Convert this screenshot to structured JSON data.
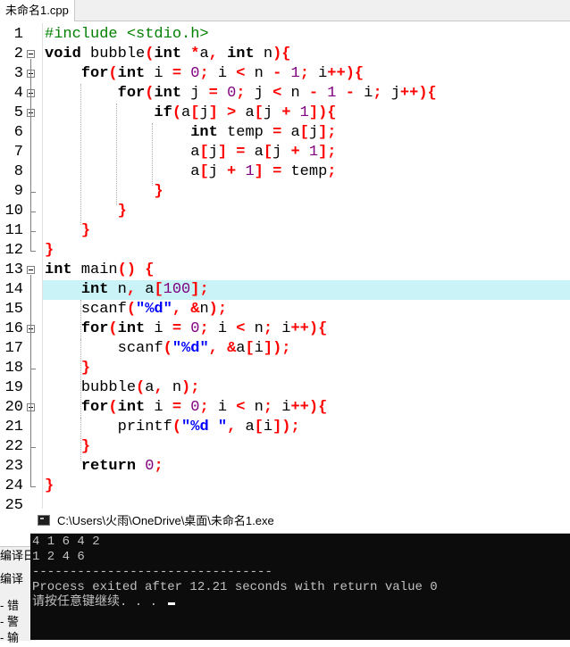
{
  "tab": {
    "label": "未命名1.cpp"
  },
  "editor": {
    "line_numbers": [
      "1",
      "2",
      "3",
      "4",
      "5",
      "6",
      "7",
      "8",
      "9",
      "10",
      "11",
      "12",
      "13",
      "14",
      "15",
      "16",
      "17",
      "18",
      "19",
      "20",
      "21",
      "22",
      "23",
      "24",
      "25"
    ]
  },
  "code": {
    "l1": [
      "#include <stdio.h>"
    ],
    "l2": [
      "void",
      " bubble",
      "(",
      "int",
      " ",
      "*",
      "a",
      ",",
      " ",
      "int",
      " n",
      ")",
      "{"
    ],
    "l3": [
      "    ",
      "for",
      "(",
      "int",
      " i ",
      "=",
      " ",
      "0",
      ";",
      " i ",
      "<",
      " n ",
      "-",
      " ",
      "1",
      ";",
      " i",
      "++",
      ")",
      "{"
    ],
    "l4": [
      "        ",
      "for",
      "(",
      "int",
      " j ",
      "=",
      " ",
      "0",
      ";",
      " j ",
      "<",
      " n ",
      "-",
      " ",
      "1",
      " ",
      "-",
      " i",
      ";",
      " j",
      "++",
      ")",
      "{"
    ],
    "l5": [
      "            ",
      "if",
      "(",
      "a",
      "[",
      "j",
      "]",
      " ",
      ">",
      " a",
      "[",
      "j ",
      "+",
      " ",
      "1",
      "]",
      ")",
      "{"
    ],
    "l6": [
      "                ",
      "int",
      " temp ",
      "=",
      " a",
      "[",
      "j",
      "]",
      ";"
    ],
    "l7": [
      "                ",
      "a",
      "[",
      "j",
      "]",
      " ",
      "=",
      " a",
      "[",
      "j ",
      "+",
      " ",
      "1",
      "]",
      ";"
    ],
    "l8": [
      "                ",
      "a",
      "[",
      "j ",
      "+",
      " ",
      "1",
      "]",
      " ",
      "=",
      " temp",
      ";"
    ],
    "l9": [
      "            ",
      "}"
    ],
    "l10": [
      "        ",
      "}"
    ],
    "l11": [
      "    ",
      "}"
    ],
    "l12": [
      "}"
    ],
    "l13": [
      "int",
      " main",
      "()",
      " ",
      "{"
    ],
    "l14": [
      "    ",
      "int",
      " n",
      ",",
      " a",
      "[",
      "100",
      "]",
      ";"
    ],
    "l15": [
      "    ",
      "scanf",
      "(",
      "\"%d\"",
      ",",
      " ",
      "&",
      "n",
      ")",
      ";"
    ],
    "l16": [
      "    ",
      "for",
      "(",
      "int",
      " i ",
      "=",
      " ",
      "0",
      ";",
      " i ",
      "<",
      " n",
      ";",
      " i",
      "++",
      ")",
      "{"
    ],
    "l17": [
      "        ",
      "scanf",
      "(",
      "\"%d\"",
      ",",
      " ",
      "&",
      "a",
      "[",
      "i",
      "]",
      ")",
      ";"
    ],
    "l18": [
      "    ",
      "}"
    ],
    "l19": [
      "    ",
      "bubble",
      "(",
      "a",
      ",",
      " n",
      ")",
      ";"
    ],
    "l20": [
      "    ",
      "for",
      "(",
      "int",
      " i ",
      "=",
      " ",
      "0",
      ";",
      " i ",
      "<",
      " n",
      ";",
      " i",
      "++",
      ")",
      "{"
    ],
    "l21": [
      "        ",
      "printf",
      "(",
      "\"%d \"",
      ",",
      " a",
      "[",
      "i",
      "]",
      ")",
      ";"
    ],
    "l22": [
      "    ",
      "}"
    ],
    "l23": [
      "    ",
      "return",
      " ",
      "0",
      ";"
    ],
    "l24": [
      "}"
    ],
    "l25": [
      ""
    ]
  },
  "bottom_panel": {
    "line1": "编译日",
    "line2": "编译",
    "line3": "- 错",
    "line4": "- 警",
    "line5": "- 输"
  },
  "console": {
    "title": "C:\\Users\\火雨\\OneDrive\\桌面\\未命名1.exe",
    "lines": [
      "4 1 6 4 2",
      "1 2 4 6",
      "--------------------------------",
      "Process exited after 12.21 seconds with return value 0",
      "请按任意键继续. . . "
    ]
  }
}
